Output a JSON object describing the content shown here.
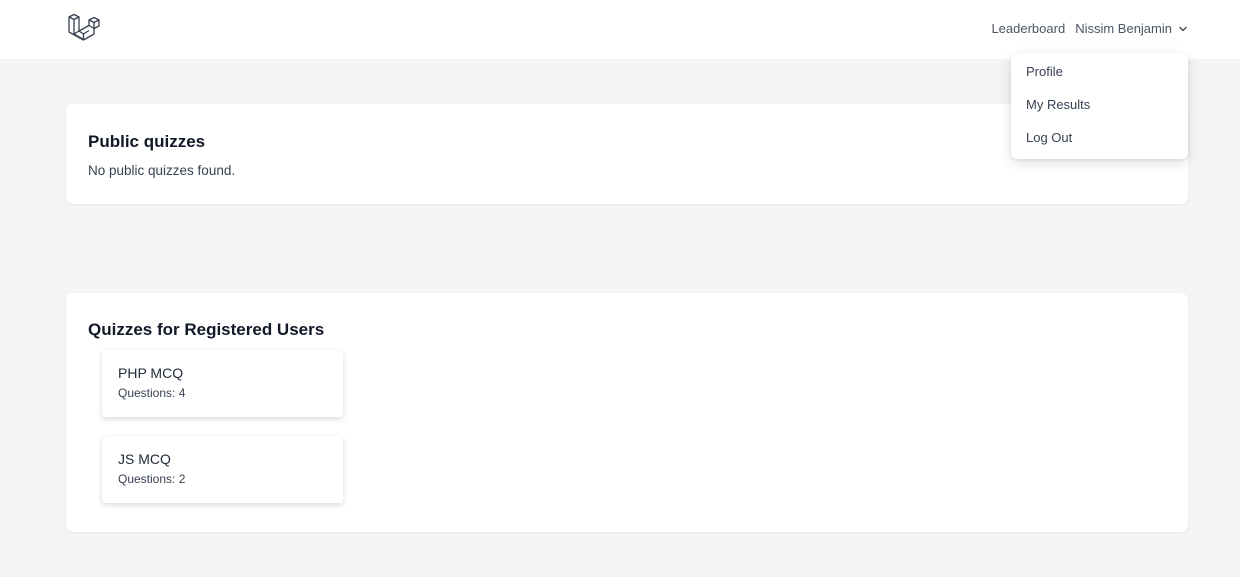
{
  "header": {
    "logo_icon": "laravel-logo-icon",
    "leaderboard_label": "Leaderboard",
    "user_name": "Nissim Benjamin",
    "chevron_icon": "chevron-down-icon"
  },
  "user_menu": {
    "items": [
      {
        "label": "Profile"
      },
      {
        "label": "My Results"
      },
      {
        "label": "Log Out"
      }
    ]
  },
  "public_section": {
    "title": "Public quizzes",
    "empty_message": "No public quizzes found."
  },
  "registered_section": {
    "title": "Quizzes for Registered Users",
    "quizzes": [
      {
        "title": "PHP MCQ",
        "questions": "Questions: 4"
      },
      {
        "title": "JS MCQ",
        "questions": "Questions: 2"
      }
    ]
  }
}
